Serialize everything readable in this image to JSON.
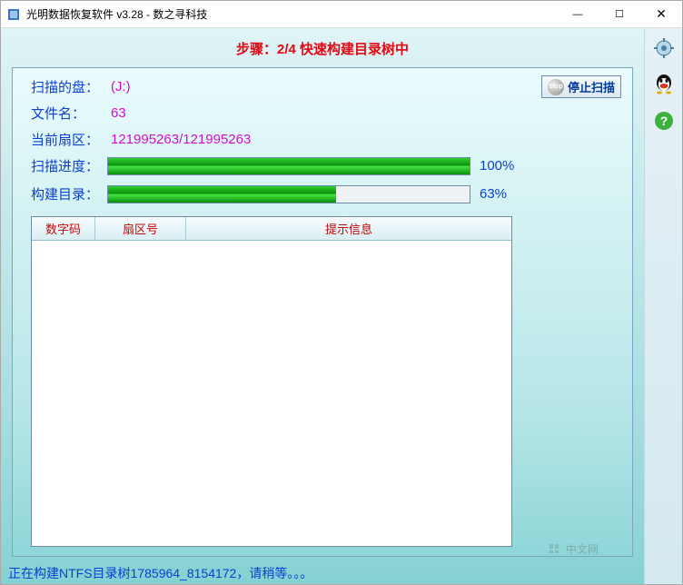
{
  "window": {
    "title": "光明数据恢复软件 v3.28 - 数之寻科技"
  },
  "step": "步骤：2/4 快速构建目录树中",
  "stop_button": "停止扫描",
  "info": {
    "disk_label": "扫描的盘：",
    "disk_value": "(J:)",
    "filename_label": "文件名：",
    "filename_value": "63",
    "sector_label": "当前扇区：",
    "sector_value": "121995263/121995263"
  },
  "progress": {
    "scan_label": "扫描进度：",
    "scan_pct": 100,
    "scan_pct_text": "100%",
    "build_label": "构建目录：",
    "build_pct": 63,
    "build_pct_text": "63%"
  },
  "table": {
    "col1": "数字码",
    "col2": "扇区号",
    "col3": "提示信息"
  },
  "status": "正在构建NTFS目录树1785964_8154172，请稍等。。。",
  "toolbar": {
    "settings": "gear-icon",
    "qq": "qq-icon",
    "help": "help-icon"
  },
  "watermark": "中文网"
}
